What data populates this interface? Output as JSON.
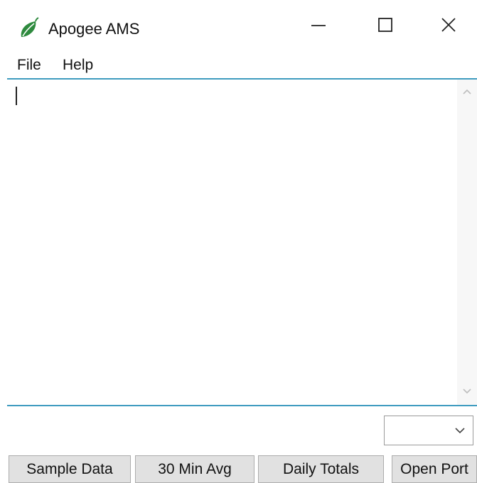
{
  "window": {
    "title": "Apogee AMS",
    "icon": "leaf-icon",
    "controls": [
      "minimize-icon",
      "maximize-icon",
      "close-icon"
    ]
  },
  "menu": {
    "items": [
      {
        "label": "File"
      },
      {
        "label": "Help"
      }
    ]
  },
  "output": {
    "text": ""
  },
  "port_select": {
    "value": ""
  },
  "buttons": {
    "sample_data": "Sample Data",
    "min_avg": "30 Min Avg",
    "daily_totals": "Daily Totals",
    "open_port": "Open Port"
  },
  "colors": {
    "accent": "#3e9bbf",
    "leaf": "#2e8a3e",
    "button_face": "#e1e1e1"
  }
}
